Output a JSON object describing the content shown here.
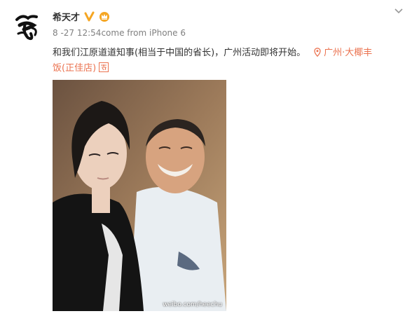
{
  "user": {
    "name": "希天才"
  },
  "meta": {
    "time": "8 -27 12:54",
    "source_prefix": "come from ",
    "source": "iPhone 6"
  },
  "post": {
    "text": "和我们江原道道知事(相当于中国的省长)，广州活动即将开始。",
    "location_line1": "广州·大椰丰",
    "location_line2": "饭(正佳店)"
  },
  "image": {
    "watermark": "weibo.com/heechu"
  },
  "colors": {
    "accent": "#eb7350",
    "badge": "#f5a623",
    "meta": "#808080"
  },
  "icons": [
    "avatar-logo",
    "verified-v-icon",
    "crown-icon",
    "chevron-down-icon",
    "location-pin-icon",
    "translate-icon"
  ]
}
